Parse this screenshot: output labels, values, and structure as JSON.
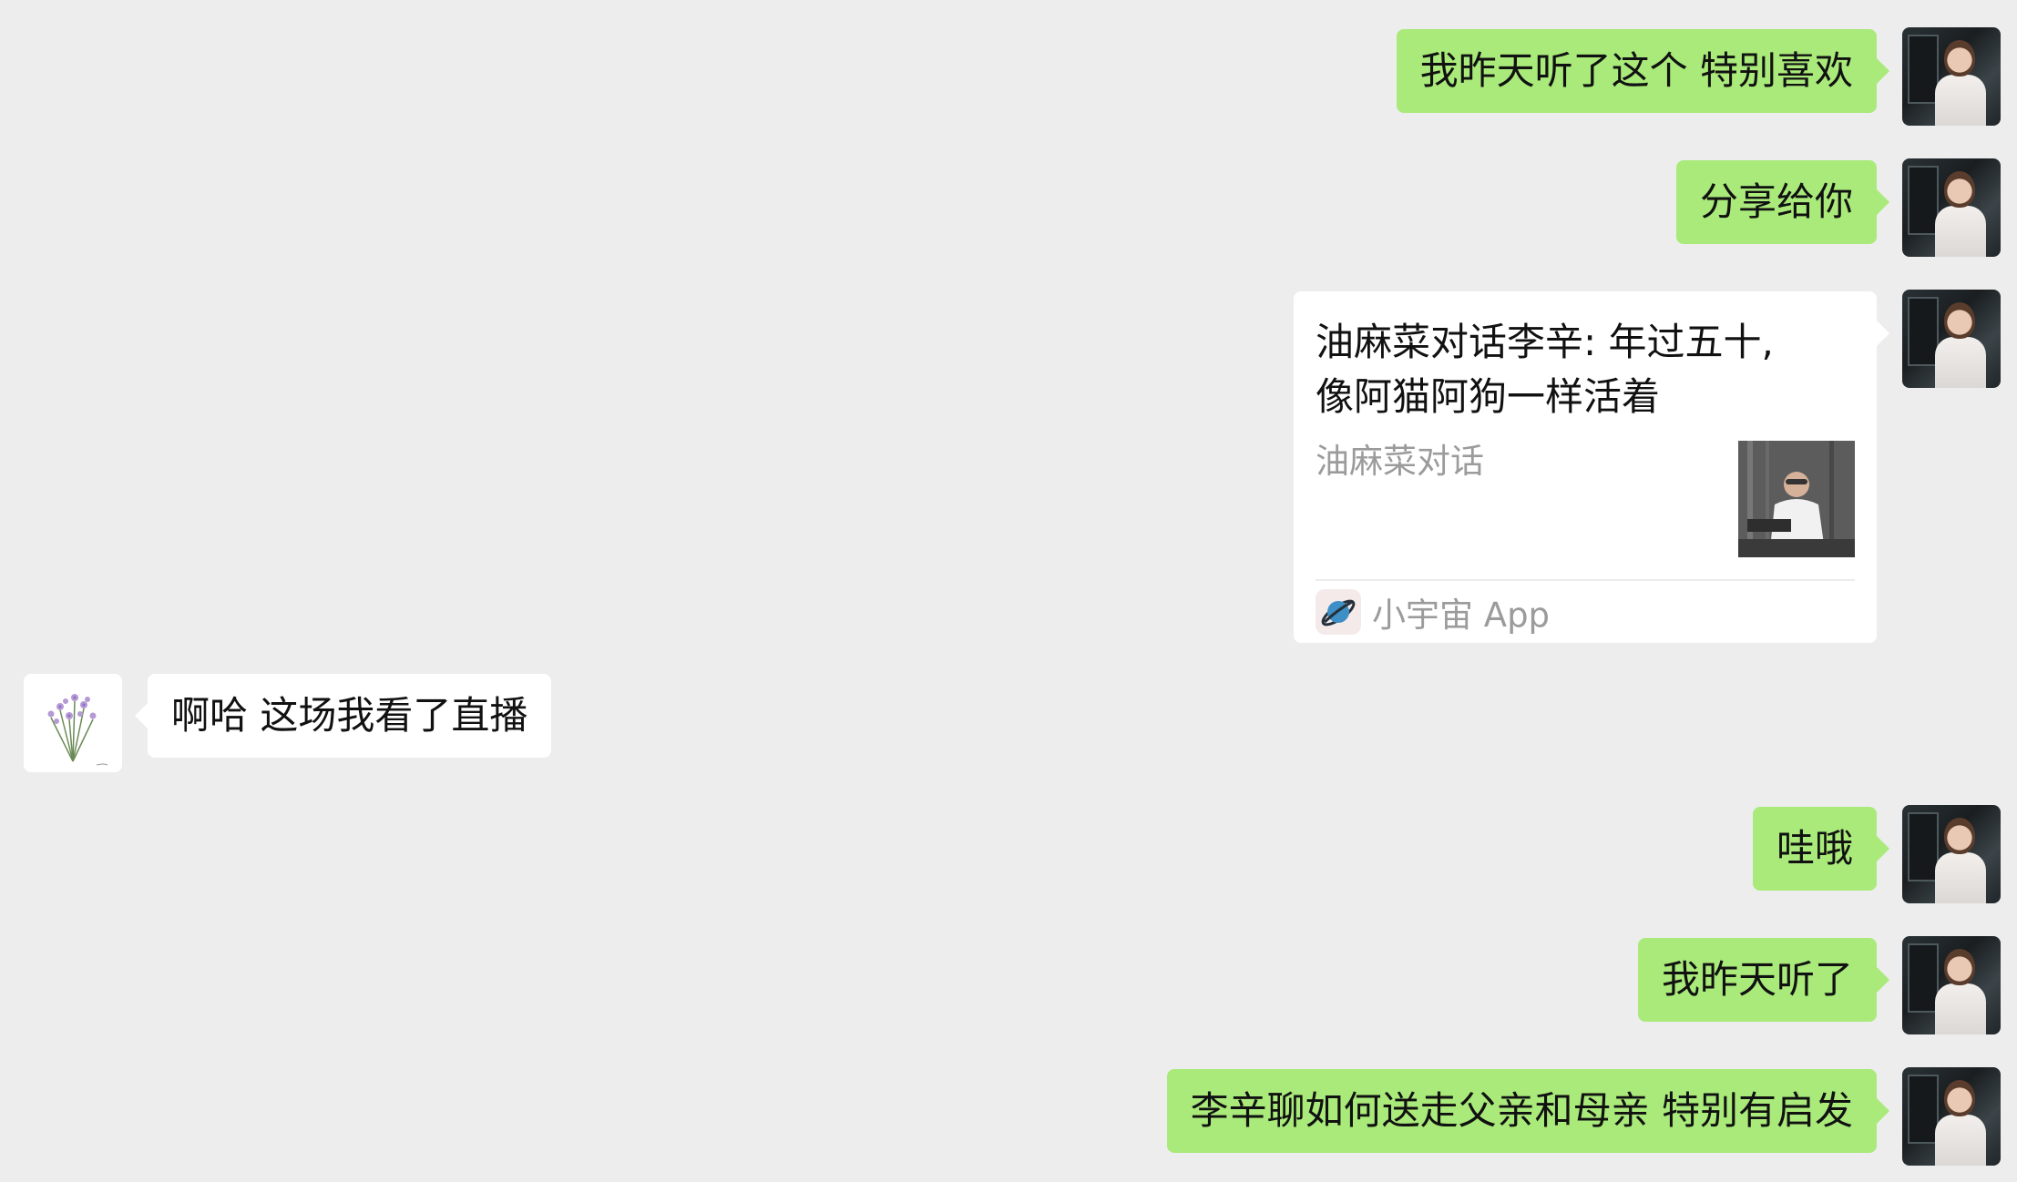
{
  "colors": {
    "background": "#ededed",
    "outgoing_bubble": "#a9ea7a",
    "incoming_bubble": "#ffffff",
    "text": "#111111",
    "secondary_text": "#9b9b9b"
  },
  "messages": [
    {
      "direction": "outgoing",
      "text": "我昨天听了这个 特别喜欢"
    },
    {
      "direction": "outgoing",
      "text": "分享给你"
    },
    {
      "direction": "outgoing",
      "type": "card",
      "card": {
        "title_line1": "油麻菜对话李辛: 年过五十,",
        "title_line2": "像阿猫阿狗一样活着",
        "source": "油麻菜对话",
        "thumbnail_icon": "podcast-thumbnail",
        "app_icon": "planet-icon",
        "app_name": "小宇宙 App"
      }
    },
    {
      "direction": "incoming",
      "text": "啊哈 这场我看了直播"
    },
    {
      "direction": "outgoing",
      "text": "哇哦"
    },
    {
      "direction": "outgoing",
      "text": "我昨天听了"
    },
    {
      "direction": "outgoing",
      "text": "李辛聊如何送走父亲和母亲 特别有启发"
    }
  ]
}
